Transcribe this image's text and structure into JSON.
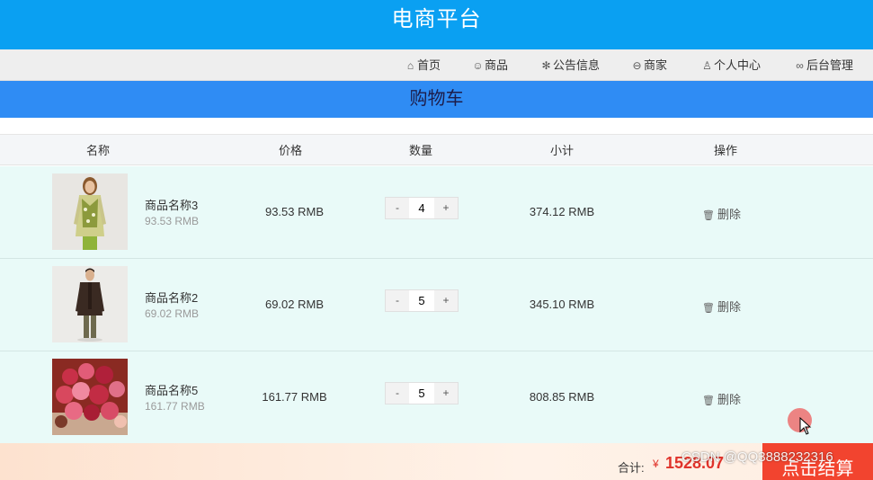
{
  "header": {
    "title": "电商平台"
  },
  "nav": {
    "items": [
      {
        "label": "首页",
        "icon": "home-icon"
      },
      {
        "label": "商品",
        "icon": "paw-icon"
      },
      {
        "label": "公告信息",
        "icon": "snowflake-icon"
      },
      {
        "label": "商家",
        "icon": "shop-icon"
      },
      {
        "label": "个人中心",
        "icon": "user-icon"
      },
      {
        "label": "后台管理",
        "icon": "link-icon"
      }
    ]
  },
  "page": {
    "title": "购物车"
  },
  "table": {
    "columns": [
      "名称",
      "价格",
      "数量",
      "小计",
      "操作"
    ],
    "rows": [
      {
        "name": "商品名称3",
        "sub": "93.53 RMB",
        "price": "93.53 RMB",
        "qty": "4",
        "subtotal": "374.12 RMB",
        "delete": "删除",
        "image": "woman-in-patterned-cardigan"
      },
      {
        "name": "商品名称2",
        "sub": "69.02 RMB",
        "price": "69.02 RMB",
        "qty": "5",
        "subtotal": "345.10 RMB",
        "delete": "删除",
        "image": "man-in-dark-jacket"
      },
      {
        "name": "商品名称5",
        "sub": "161.77 RMB",
        "price": "161.77 RMB",
        "qty": "5",
        "subtotal": "808.85 RMB",
        "delete": "删除",
        "image": "red-flower-bouquet"
      }
    ],
    "stepper": {
      "minus": "-",
      "plus": "+"
    }
  },
  "footer": {
    "total_label": "合计:",
    "currency": "¥",
    "total": "1528.07",
    "checkout": "点击结算",
    "watermark": "CSDN @QQ3888232316"
  },
  "colors": {
    "topbar": "#0aa0f2",
    "titlebar": "#2f8cf4",
    "row_bg": "#e9faf8",
    "accent_red": "#e0332b",
    "checkout": "#f2442f"
  }
}
